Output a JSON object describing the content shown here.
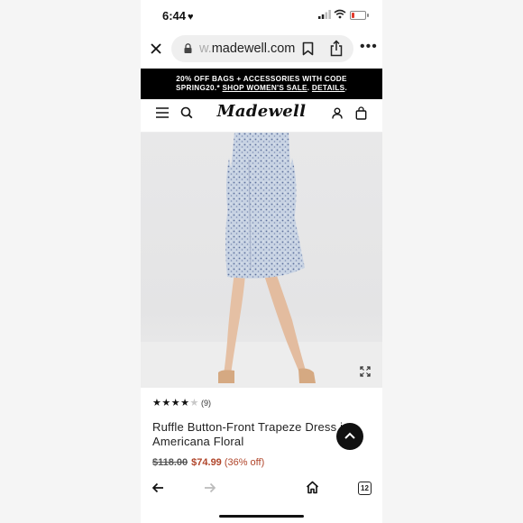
{
  "status": {
    "time": "6:44",
    "heart": "♥"
  },
  "browser": {
    "url_faded": "w.",
    "url_main": "madewell.com"
  },
  "promo": {
    "line1": "20% OFF BAGS + ACCESSORIES WITH CODE",
    "code": "SPRING20.*",
    "link1": "SHOP WOMEN'S SALE",
    "link2": "DETAILS",
    "sep1": " ",
    "sep2": ". ",
    "end": "."
  },
  "nav": {
    "logo": "Madewell"
  },
  "product": {
    "stars_filled": "★★★★",
    "stars_empty": "★",
    "rating": 4,
    "review_count": "(9)",
    "title": "Ruffle Button-Front Trapeze Dress in Americana Floral",
    "original_price": "$118.00",
    "sale_price": "$74.99",
    "discount": "(36% off)"
  },
  "gallery": {
    "slides": 4,
    "active_slide": 3
  },
  "colors": {
    "sale": "#b0452a",
    "promo_bg": "#000000",
    "battery_low": "#e23b2e"
  },
  "bottom": {
    "tab_count": "12"
  }
}
